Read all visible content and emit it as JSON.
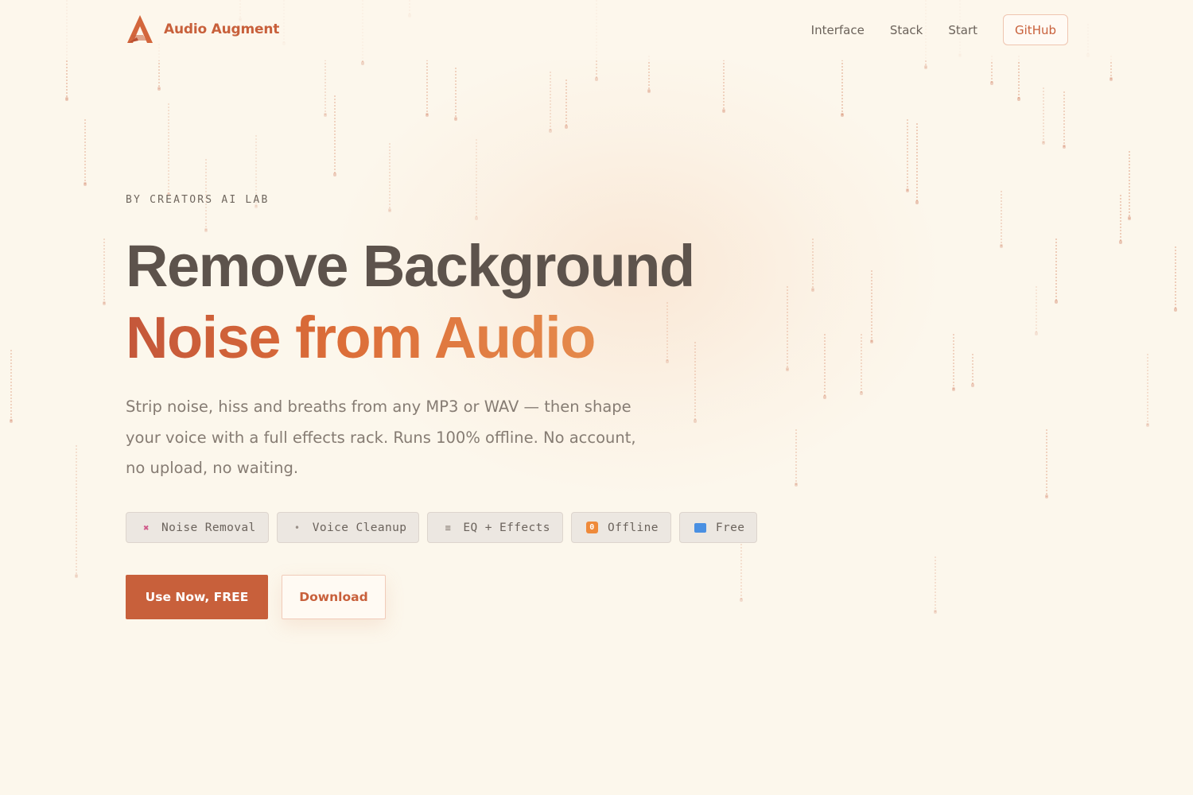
{
  "brand": {
    "name": "Audio Augment",
    "logo_icon": "audio-augment-logo-icon"
  },
  "nav": {
    "links": [
      "Interface",
      "Stack",
      "Start"
    ],
    "github_label": "GitHub"
  },
  "hero": {
    "eyebrow": "BY CREATORS AI LAB",
    "title_line1": "Remove Background",
    "title_line2": "Noise from Audio",
    "lede": "Strip noise, hiss and breaths from any MP3 or WAV — then shape your voice with a full effects rack. Runs 100% offline. No account, no upload, no waiting.",
    "chips": [
      {
        "icon": "muted-speaker-icon",
        "label": "Noise Removal"
      },
      {
        "icon": "microphone-icon",
        "label": "Voice Cleanup"
      },
      {
        "icon": "equalizer-icon",
        "label": "EQ + Effects"
      },
      {
        "icon": "offline-icon",
        "label": "Offline"
      },
      {
        "icon": "free-badge-icon",
        "label": "Free"
      }
    ],
    "primary_cta": "Use Now, FREE",
    "secondary_cta": "Download"
  },
  "colors": {
    "accent": "#c8603b",
    "background": "#fcf7ec",
    "heading": "#5d534c",
    "body_text": "#867c73"
  }
}
